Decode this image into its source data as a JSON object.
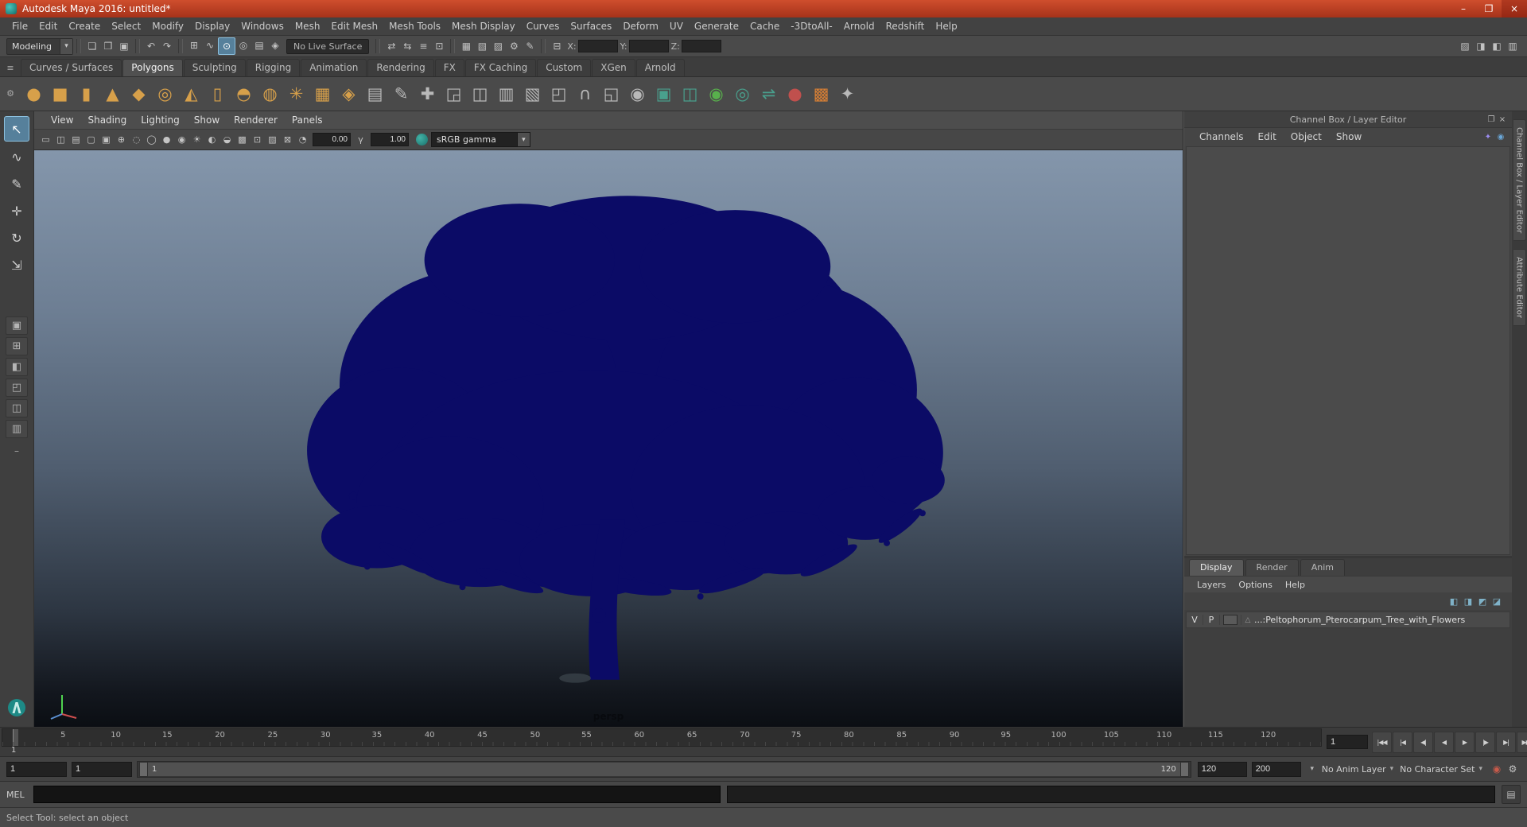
{
  "colors": {
    "titlebar": "#b8402a",
    "accent": "#56809b",
    "shelf_gold": "#d7a04a",
    "shelf_teal": "#49a08d",
    "tree": "#0b0b66",
    "viewport_top": "#8496ab",
    "viewport_bottom": "#0b0e13"
  },
  "window": {
    "title": "Autodesk Maya 2016: untitled*",
    "minimize": "–",
    "maximize": "❐",
    "close": "×"
  },
  "menubar": [
    "File",
    "Edit",
    "Create",
    "Select",
    "Modify",
    "Display",
    "Windows",
    "Mesh",
    "Edit Mesh",
    "Mesh Tools",
    "Mesh Display",
    "Curves",
    "Surfaces",
    "Deform",
    "UV",
    "Generate",
    "Cache",
    "-3DtoAll-",
    "Arnold",
    "Redshift",
    "Help"
  ],
  "statusline": {
    "mode": "Modeling",
    "caret": "▾",
    "file_icons": [
      {
        "name": "new-scene-icon",
        "glyph": "❏"
      },
      {
        "name": "open-scene-icon",
        "glyph": "❒"
      },
      {
        "name": "save-scene-icon",
        "glyph": "▣"
      }
    ],
    "edit_icons": [
      {
        "name": "undo-icon",
        "glyph": "↶"
      },
      {
        "name": "redo-icon",
        "glyph": "↷"
      }
    ],
    "snap_icons": [
      {
        "name": "snap-to-grids-icon",
        "glyph": "⊞"
      },
      {
        "name": "snap-to-curves-icon",
        "glyph": "∿"
      },
      {
        "name": "snap-to-points-icon",
        "glyph": "⊙",
        "active": true
      },
      {
        "name": "snap-to-projected-center-icon",
        "glyph": "◎"
      },
      {
        "name": "snap-to-view-planes-icon",
        "glyph": "▤"
      },
      {
        "name": "make-live-icon",
        "glyph": "◈"
      }
    ],
    "live_surface": "No Live Surface",
    "history_icons": [
      {
        "name": "input-connections-icon",
        "glyph": "⇄"
      },
      {
        "name": "output-connections-icon",
        "glyph": "⇆"
      },
      {
        "name": "construction-history-icon",
        "glyph": "≡"
      },
      {
        "name": "modeling-toolkit-icon",
        "glyph": "⊡"
      }
    ],
    "render_icons": [
      {
        "name": "render-view-icon",
        "glyph": "▦"
      },
      {
        "name": "render-current-frame-icon",
        "glyph": "▧"
      },
      {
        "name": "ipr-render-icon",
        "glyph": "▨"
      },
      {
        "name": "render-settings-icon",
        "glyph": "⚙"
      },
      {
        "name": "paint-effects-icon",
        "glyph": "✎"
      }
    ],
    "symmetry_icon": {
      "name": "symmetry-icon",
      "glyph": "⊟"
    },
    "coords": [
      {
        "label": "X:"
      },
      {
        "label": "Y:"
      },
      {
        "label": "Z:"
      }
    ],
    "sidebar_icons": [
      {
        "name": "toggle-modeling-toolkit-icon",
        "glyph": "▨"
      },
      {
        "name": "toggle-attribute-editor-icon",
        "glyph": "◨"
      },
      {
        "name": "toggle-tool-settings-icon",
        "glyph": "◧"
      },
      {
        "name": "toggle-channel-box-icon",
        "glyph": "▥"
      }
    ]
  },
  "shelf": {
    "tabs_menu_icon": {
      "name": "shelf-tabs-menu-icon",
      "glyph": "≡"
    },
    "gear_menu_icon": {
      "name": "shelf-options-menu-icon",
      "glyph": "⚙"
    },
    "tabs": [
      {
        "label": "Curves / Surfaces"
      },
      {
        "label": "Polygons",
        "active": true
      },
      {
        "label": "Sculpting"
      },
      {
        "label": "Rigging"
      },
      {
        "label": "Animation"
      },
      {
        "label": "Rendering"
      },
      {
        "label": "FX"
      },
      {
        "label": "FX Caching"
      },
      {
        "label": "Custom"
      },
      {
        "label": "XGen"
      },
      {
        "label": "Arnold"
      }
    ],
    "items": [
      {
        "name": "poly-sphere-icon",
        "glyph": "●",
        "color": "#d7a04a"
      },
      {
        "name": "poly-cube-icon",
        "glyph": "■",
        "color": "#d7a04a"
      },
      {
        "name": "poly-cylinder-icon",
        "glyph": "▮",
        "color": "#d7a04a"
      },
      {
        "name": "poly-cone-icon",
        "glyph": "▲",
        "color": "#d7a04a"
      },
      {
        "name": "poly-plane-icon",
        "glyph": "◆",
        "color": "#d7a04a"
      },
      {
        "name": "poly-torus-icon",
        "glyph": "◎",
        "color": "#d7a04a"
      },
      {
        "name": "poly-pyramid-icon",
        "glyph": "◭",
        "color": "#d7a04a"
      },
      {
        "name": "poly-pipe-icon",
        "glyph": "▯",
        "color": "#d7a04a"
      },
      {
        "name": "poly-dome-icon",
        "glyph": "◓",
        "color": "#d7a04a"
      },
      {
        "name": "poly-uv-sphere-icon",
        "glyph": "◍",
        "color": "#d7a04a"
      },
      {
        "name": "poly-gear-icon",
        "glyph": "✳",
        "color": "#d7a04a"
      },
      {
        "name": "poly-plane-grid-icon",
        "glyph": "▦",
        "color": "#d7a04a"
      },
      {
        "name": "poly-platonic-icon",
        "glyph": "◈",
        "color": "#d7a04a"
      },
      {
        "name": "sculpt-tool-icon",
        "glyph": "▤",
        "color": "#b9b9b9"
      },
      {
        "name": "create-polygon-tool-icon",
        "glyph": "✎",
        "color": "#b9b9b9"
      },
      {
        "name": "append-to-polygon-icon",
        "glyph": "✚",
        "color": "#b9b9b9"
      },
      {
        "name": "quad-draw-tool-icon",
        "glyph": "◲",
        "color": "#b9b9b9"
      },
      {
        "name": "multi-cut-tool-icon",
        "glyph": "◫",
        "color": "#b9b9b9"
      },
      {
        "name": "insert-edge-loop-icon",
        "glyph": "▥",
        "color": "#b9b9b9"
      },
      {
        "name": "offset-edge-loop-icon",
        "glyph": "▧",
        "color": "#b9b9b9"
      },
      {
        "name": "bevel-icon",
        "glyph": "◰",
        "color": "#b9b9b9"
      },
      {
        "name": "bridge-icon",
        "glyph": "∩",
        "color": "#b9b9b9"
      },
      {
        "name": "extrude-icon",
        "glyph": "◱",
        "color": "#b9b9b9"
      },
      {
        "name": "smooth-icon",
        "glyph": "◉",
        "color": "#b9b9b9"
      },
      {
        "name": "combine-icon",
        "glyph": "▣",
        "color": "#49a08d"
      },
      {
        "name": "separate-icon",
        "glyph": "◫",
        "color": "#49a08d"
      },
      {
        "name": "smooth-proxy-icon",
        "glyph": "◉",
        "color": "#58b04c"
      },
      {
        "name": "boolean-union-icon",
        "glyph": "◎",
        "color": "#49a08d"
      },
      {
        "name": "mirror-icon",
        "glyph": "⇌",
        "color": "#49a08d"
      },
      {
        "name": "sculpt-objects-icon",
        "glyph": "●",
        "color": "#c0504d"
      },
      {
        "name": "uv-checker-icon",
        "glyph": "▩",
        "color": "#d77f35"
      },
      {
        "name": "node-editor-icon",
        "glyph": "✦",
        "color": "#b9b9b9"
      }
    ]
  },
  "toolbox": {
    "tools": [
      {
        "name": "select-tool",
        "glyph": "↖",
        "active": true
      },
      {
        "name": "lasso-select-tool",
        "glyph": "∿"
      },
      {
        "name": "paint-select-tool",
        "glyph": "✎"
      },
      {
        "name": "move-tool",
        "glyph": "✛"
      },
      {
        "name": "rotate-tool",
        "glyph": "↻"
      },
      {
        "name": "scale-tool",
        "glyph": "⇲"
      }
    ],
    "layouts": [
      {
        "name": "layout-single-pane-button",
        "glyph": "▣"
      },
      {
        "name": "layout-four-pane-button",
        "glyph": "⊞"
      },
      {
        "name": "layout-persp-outliner-button",
        "glyph": "◧"
      },
      {
        "name": "layout-persp-graph-button",
        "glyph": "◰"
      },
      {
        "name": "layout-hypershade-button",
        "glyph": "◫"
      },
      {
        "name": "layout-persp-uv-button",
        "glyph": "▥"
      }
    ],
    "collapse": "–"
  },
  "panel": {
    "menus": [
      "View",
      "Shading",
      "Lighting",
      "Show",
      "Renderer",
      "Panels"
    ],
    "icons": [
      {
        "name": "select-camera-icon",
        "glyph": "▭"
      },
      {
        "name": "lock-camera-icon",
        "glyph": "◫"
      },
      {
        "name": "camera-attributes-icon",
        "glyph": "▤"
      },
      {
        "name": "bookmarks-icon",
        "glyph": "▢"
      },
      {
        "name": "image-plane-icon",
        "glyph": "▣"
      },
      {
        "name": "two-d-pan-zoom-icon",
        "glyph": "⊕"
      },
      {
        "name": "oversampling-icon",
        "glyph": "◌"
      },
      {
        "name": "wireframe-mode-icon",
        "glyph": "◯"
      },
      {
        "name": "shaded-mode-icon",
        "glyph": "●"
      },
      {
        "name": "textured-mode-icon",
        "glyph": "◉"
      },
      {
        "name": "use-all-lights-icon",
        "glyph": "☀"
      },
      {
        "name": "shadows-icon",
        "glyph": "◐"
      },
      {
        "name": "ambient-occlusion-icon",
        "glyph": "◒"
      },
      {
        "name": "anti-alias-icon",
        "glyph": "▩"
      },
      {
        "name": "isolate-select-icon",
        "glyph": "⊡"
      },
      {
        "name": "xray-icon",
        "glyph": "▨"
      },
      {
        "name": "joint-xray-icon",
        "glyph": "⊠"
      }
    ],
    "exposure_icon": "◔",
    "exposure": "0.00",
    "gamma_icon": "γ",
    "gamma": "1.00",
    "view_transform": "sRGB gamma",
    "caret": "▾",
    "camera": "persp"
  },
  "channel_box": {
    "title": "Channel Box / Layer Editor",
    "float_icon": "❐",
    "close_icon": "×",
    "menus": [
      "Channels",
      "Edit",
      "Object",
      "Show"
    ],
    "menu_icons": [
      {
        "name": "channel-slider-mode-icon",
        "glyph": "✦",
        "color": "#9b8cf0"
      },
      {
        "name": "channel-speed-icon",
        "glyph": "◉",
        "color": "#6aa7d8"
      }
    ]
  },
  "side_tabs": [
    {
      "label": "Channel Box / Layer Editor"
    },
    {
      "label": "Attribute Editor"
    }
  ],
  "layer_editor": {
    "tabs": [
      {
        "label": "Display",
        "active": true
      },
      {
        "label": "Render"
      },
      {
        "label": "Anim"
      }
    ],
    "menus": [
      "Layers",
      "Options",
      "Help"
    ],
    "toolbar_icons": [
      {
        "name": "layer-move-up-icon",
        "glyph": "◧",
        "color": "#7fb2c8"
      },
      {
        "name": "layer-move-down-icon",
        "glyph": "◨",
        "color": "#7fb2c8"
      },
      {
        "name": "new-empty-layer-icon",
        "glyph": "◩",
        "color": "#7fb2c8"
      },
      {
        "name": "new-layer-from-selected-icon",
        "glyph": "◪",
        "color": "#7fb2c8"
      }
    ],
    "layer": {
      "v": "V",
      "p": "P",
      "type_glyph": "△",
      "name": "...:Peltophorum_Pterocarpum_Tree_with_Flowers"
    }
  },
  "timeline": {
    "playhead_label": "1",
    "frame": "1",
    "ticks": [
      {
        "label": "5",
        "left": "4.6%"
      },
      {
        "label": "10",
        "left": "8.6%"
      },
      {
        "label": "15",
        "left": "12.5%"
      },
      {
        "label": "20",
        "left": "16.5%"
      },
      {
        "label": "25",
        "left": "20.5%"
      },
      {
        "label": "30",
        "left": "24.5%"
      },
      {
        "label": "35",
        "left": "28.4%"
      },
      {
        "label": "40",
        "left": "32.4%"
      },
      {
        "label": "45",
        "left": "36.4%"
      },
      {
        "label": "50",
        "left": "40.4%"
      },
      {
        "label": "55",
        "left": "44.3%"
      },
      {
        "label": "60",
        "left": "48.3%"
      },
      {
        "label": "65",
        "left": "52.3%"
      },
      {
        "label": "70",
        "left": "56.3%"
      },
      {
        "label": "75",
        "left": "60.2%"
      },
      {
        "label": "80",
        "left": "64.2%"
      },
      {
        "label": "85",
        "left": "68.2%"
      },
      {
        "label": "90",
        "left": "72.2%"
      },
      {
        "label": "95",
        "left": "76.1%"
      },
      {
        "label": "100",
        "left": "80.1%"
      },
      {
        "label": "105",
        "left": "84.1%"
      },
      {
        "label": "110",
        "left": "88.1%"
      },
      {
        "label": "115",
        "left": "92.0%"
      },
      {
        "label": "120",
        "left": "96.0%"
      }
    ],
    "transport": [
      {
        "name": "go-to-start-button",
        "glyph": "|◀◀"
      },
      {
        "name": "step-back-key-button",
        "glyph": "|◀"
      },
      {
        "name": "step-back-frame-button",
        "glyph": "◀|"
      },
      {
        "name": "play-backwards-button",
        "glyph": "◀"
      },
      {
        "name": "play-forwards-button",
        "glyph": "▶"
      },
      {
        "name": "step-forward-frame-button",
        "glyph": "|▶"
      },
      {
        "name": "step-forward-key-button",
        "glyph": "▶|"
      },
      {
        "name": "go-to-end-button",
        "glyph": "▶▶|"
      }
    ]
  },
  "range_slider": {
    "anim_start": "1",
    "play_start": "1",
    "range_start": "1",
    "range_end": "120",
    "play_end": "120",
    "anim_end": "200",
    "caret": "▾",
    "anim_layer": "No Anim Layer",
    "character_set": "No Character Set",
    "autokey_icon": {
      "name": "auto-keyframe-toggle",
      "glyph": "◉",
      "color": "#c85a4a"
    },
    "prefs_icon": {
      "name": "animation-preferences-button",
      "glyph": "⚙"
    }
  },
  "command_line": {
    "label": "MEL",
    "icon": "▤"
  },
  "help_line": {
    "text": "Select Tool: select an object"
  }
}
